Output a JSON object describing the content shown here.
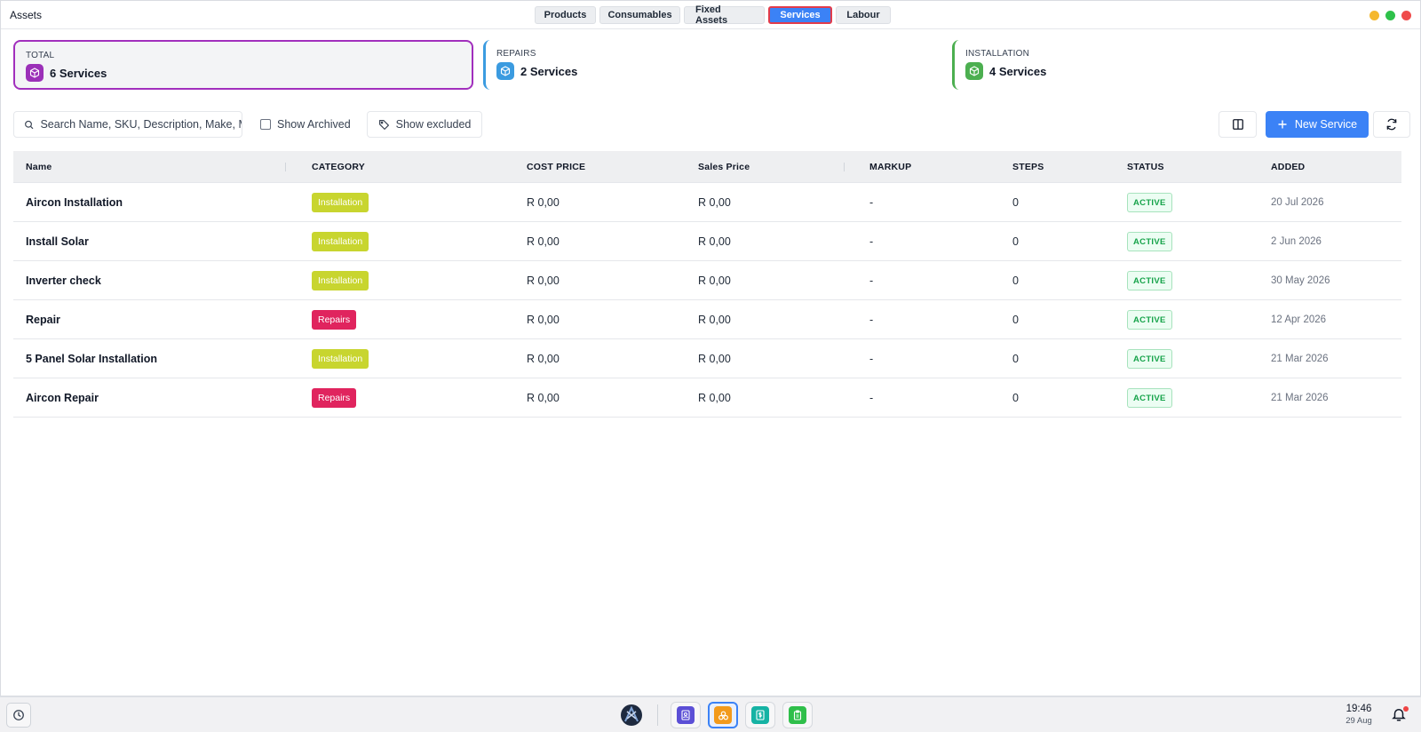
{
  "window": {
    "title": "Assets"
  },
  "tabs": [
    {
      "label": "Products",
      "active": false
    },
    {
      "label": "Consumables",
      "active": false
    },
    {
      "label": "Fixed Assets",
      "active": false
    },
    {
      "label": "Services",
      "active": true
    },
    {
      "label": "Labour",
      "active": false
    }
  ],
  "window_controls": {
    "minimize_color": "#f5b82e",
    "maximize_color": "#2ec14a",
    "close_color": "#ef4b4b"
  },
  "summary": {
    "total": {
      "label": "TOTAL",
      "value": "6 Services",
      "icon": "box-icon",
      "color": "#9b30b8"
    },
    "repairs": {
      "label": "REPAIRS",
      "value": "2 Services",
      "icon": "box-icon",
      "color": "#3b9be0"
    },
    "installation": {
      "label": "INSTALLATION",
      "value": "4 Services",
      "icon": "box-icon",
      "color": "#4caf50"
    }
  },
  "toolbar": {
    "search_placeholder": "Search Name, SKU, Description, Make, Model",
    "show_archived_label": "Show Archived",
    "show_archived_checked": false,
    "show_excluded_label": "Show excluded",
    "new_service_label": "New Service",
    "accent": "#3b82f6"
  },
  "table": {
    "columns": [
      "Name",
      "CATEGORY",
      "COST PRICE",
      "Sales Price",
      "MARKUP",
      "STEPS",
      "STATUS",
      "ADDED"
    ],
    "rows": [
      {
        "name": "Aircon Installation",
        "category": "Installation",
        "cost": "R 0,00",
        "sales": "R 0,00",
        "markup": "-",
        "steps": "0",
        "status": "ACTIVE",
        "added": "20 Jul 2026"
      },
      {
        "name": "Install Solar",
        "category": "Installation",
        "cost": "R 0,00",
        "sales": "R 0,00",
        "markup": "-",
        "steps": "0",
        "status": "ACTIVE",
        "added": "2 Jun 2026"
      },
      {
        "name": "Inverter check",
        "category": "Installation",
        "cost": "R 0,00",
        "sales": "R 0,00",
        "markup": "-",
        "steps": "0",
        "status": "ACTIVE",
        "added": "30 May 2026"
      },
      {
        "name": "Repair",
        "category": "Repairs",
        "cost": "R 0,00",
        "sales": "R 0,00",
        "markup": "-",
        "steps": "0",
        "status": "ACTIVE",
        "added": "12 Apr 2026"
      },
      {
        "name": "5 Panel Solar Installation",
        "category": "Installation",
        "cost": "R 0,00",
        "sales": "R 0,00",
        "markup": "-",
        "steps": "0",
        "status": "ACTIVE",
        "added": "21 Mar 2026"
      },
      {
        "name": "Aircon Repair",
        "category": "Repairs",
        "cost": "R 0,00",
        "sales": "R 0,00",
        "markup": "-",
        "steps": "0",
        "status": "ACTIVE",
        "added": "21 Mar 2026"
      }
    ],
    "category_colors": {
      "Installation": "#c8d52f",
      "Repairs": "#e0245e"
    }
  },
  "taskbar": {
    "time": "19:46",
    "date": "29 Aug",
    "apps": [
      {
        "name": "contacts-app-icon",
        "color": "#5b4fd6",
        "active": false
      },
      {
        "name": "assets-app-icon",
        "color": "#f29a1c",
        "active": true
      },
      {
        "name": "invoice-app-icon",
        "color": "#16b3a4",
        "active": false
      },
      {
        "name": "clipboard-app-icon",
        "color": "#2fbf4a",
        "active": false
      }
    ]
  }
}
